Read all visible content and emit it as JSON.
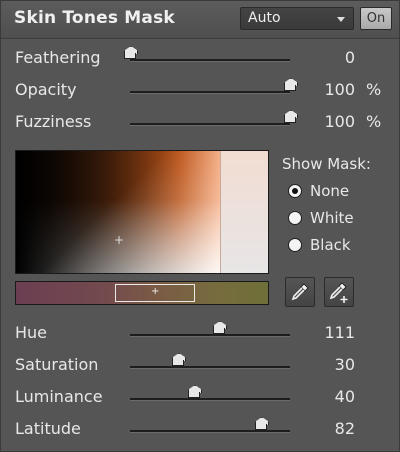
{
  "header": {
    "title": "Skin Tones Mask",
    "mode_selected": "Auto",
    "on_label": "On"
  },
  "controls": {
    "feathering": {
      "label": "Feathering",
      "value": "0",
      "unit": ""
    },
    "opacity": {
      "label": "Opacity",
      "value": "100",
      "unit": "%"
    },
    "fuzziness": {
      "label": "Fuzziness",
      "value": "100",
      "unit": "%"
    }
  },
  "show_mask": {
    "title": "Show Mask:",
    "options": [
      {
        "label": "None",
        "selected": true
      },
      {
        "label": "White",
        "selected": false
      },
      {
        "label": "Black",
        "selected": false
      }
    ]
  },
  "tools": {
    "eyedropper_icon": "eyedropper-icon",
    "eyedropper_add_icon": "eyedropper-plus-icon"
  },
  "adjustments": {
    "hue": {
      "label": "Hue",
      "value": "111"
    },
    "saturation": {
      "label": "Saturation",
      "value": "30"
    },
    "luminance": {
      "label": "Luminance",
      "value": "40"
    },
    "latitude": {
      "label": "Latitude",
      "value": "82"
    }
  },
  "colors": {
    "panel_bg": "#555555",
    "text": "#e8e8e8",
    "accent_orange": "#e8661c"
  }
}
